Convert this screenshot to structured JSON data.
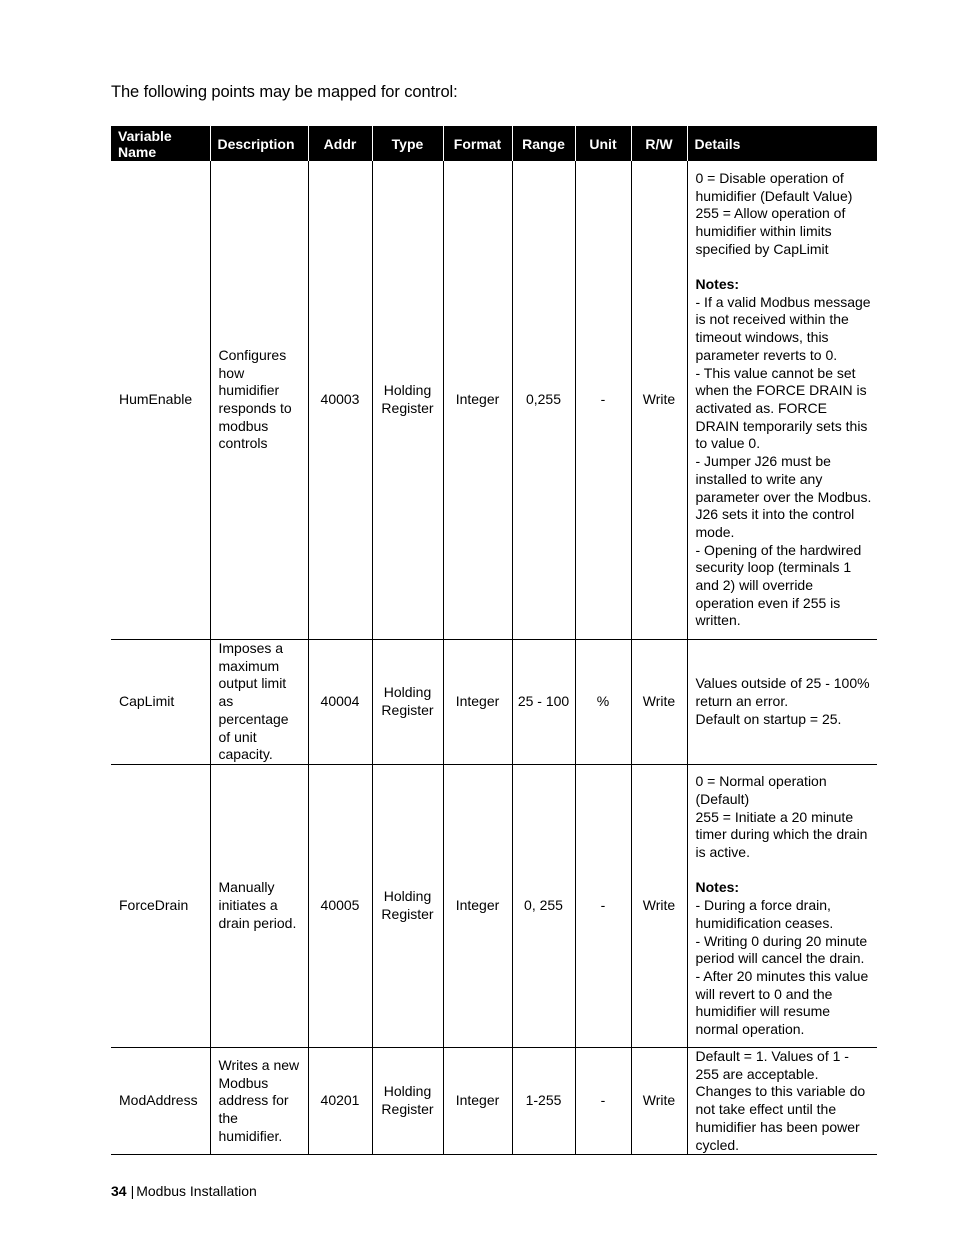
{
  "intro": "The following points may be mapped for control:",
  "table": {
    "headers": {
      "variable_name": "Variable Name",
      "description": "Description",
      "addr": "Addr",
      "type": "Type",
      "format": "Format",
      "range": "Range",
      "unit": "Unit",
      "rw": "R/W",
      "details": "Details"
    },
    "rows": [
      {
        "variable_name": "HumEnable",
        "description": "Configures how humidifier responds to modbus controls",
        "addr": "40003",
        "type": "Holding Register",
        "format": "Integer",
        "range": "0,255",
        "unit": "-",
        "rw": "Write",
        "details": {
          "lines": [
            "0 = Disable operation of humidifier (Default Value)",
            "255 = Allow operation of humidifier within limits specified by CapLimit"
          ],
          "notes_label": "Notes:",
          "notes": [
            "- If a valid Modbus message is not received within the timeout windows, this parameter reverts to 0.",
            "- This value cannot be set when the FORCE DRAIN is activated as. FORCE DRAIN temporarily sets this to value 0.",
            "- Jumper J26 must be installed to write any parameter over the Modbus. J26 sets it into the control mode.",
            "- Opening of the hardwired security loop (terminals 1 and 2) will override operation even if 255 is written."
          ]
        }
      },
      {
        "variable_name": "CapLimit",
        "description": "Imposes a maximum output limit as percentage of unit capacity.",
        "addr": "40004",
        "type": "Holding Register",
        "format": "Integer",
        "range": "25 - 100",
        "unit": "%",
        "rw": "Write",
        "details": {
          "lines": [
            "Values outside of 25 - 100% return an error.",
            "Default on startup = 25."
          ]
        }
      },
      {
        "variable_name": "ForceDrain",
        "description": "Manually initiates a drain period.",
        "addr": "40005",
        "type": "Holding Register",
        "format": "Integer",
        "range": "0, 255",
        "unit": "-",
        "rw": "Write",
        "details": {
          "lines": [
            "0 = Normal operation (Default)",
            "255 =  Initiate a 20 minute timer during which the drain is active."
          ],
          "notes_label": "Notes:",
          "notes": [
            "- During a force drain, humidification ceases.",
            "- Writing 0 during 20 minute period will cancel the drain.",
            "- After 20 minutes this value will revert to 0 and the humidifier will resume normal operation."
          ]
        }
      },
      {
        "variable_name": "ModAddress",
        "description": "Writes a new Modbus address for the humidifier.",
        "addr": "40201",
        "type": "Holding Register",
        "format": "Integer",
        "range": "1-255",
        "unit": "-",
        "rw": "Write",
        "details": {
          "lines": [
            "Default = 1.  Values of 1 - 255 are acceptable. Changes to this variable do not take effect until the humidifier has been power cycled."
          ]
        }
      }
    ]
  },
  "footer": {
    "page_number": "34",
    "separator": "|",
    "section": "Modbus Installation"
  }
}
